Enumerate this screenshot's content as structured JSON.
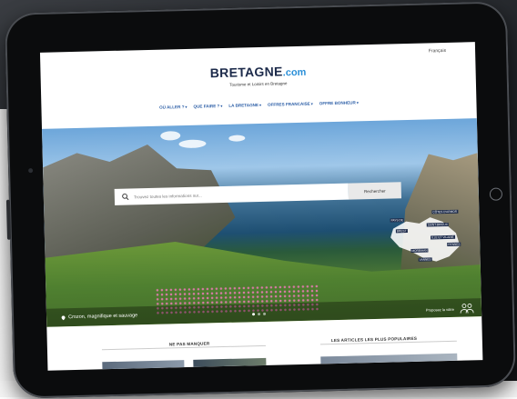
{
  "site": {
    "language": "Français",
    "logo_main": "BRETAGNE",
    "logo_tld": ".com",
    "tagline": "Tourisme et Loisirs en Bretagne"
  },
  "nav": {
    "items": [
      {
        "label": "OÙ ALLER ?"
      },
      {
        "label": "QUE FAIRE ?"
      },
      {
        "label": "LA BRETAGNE"
      },
      {
        "label": "OFFRES FRANCAISE"
      },
      {
        "label": "OFFRE BONHEUR"
      }
    ]
  },
  "search": {
    "placeholder": "Trouvez toutes les informations sur...",
    "button": "Rechercher"
  },
  "map": {
    "labels": [
      "PAYS DE",
      "CÔTES D'ARMOR",
      "SAINT-BRIEUC",
      "BREST",
      "ILLE ET VILAINE",
      "RENNES",
      "MORBIHAN",
      "VANNES"
    ]
  },
  "hero": {
    "caption": "Crozon, magnifique et sauvage",
    "caption_right": "Proposez la vôtre"
  },
  "sections": {
    "left": "NE PAS MANQUER",
    "right": "LES ARTICLES LES PLUS POPULAIRES"
  },
  "colors": {
    "brand": "#1c2a4a",
    "accent": "#2a8fd8",
    "nav": "#2d5fa7"
  }
}
